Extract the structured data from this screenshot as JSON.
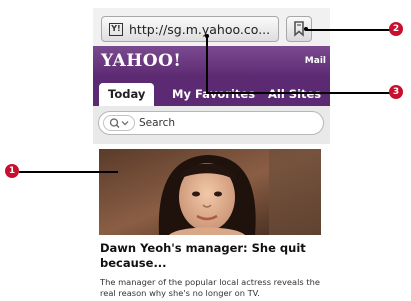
{
  "browser": {
    "url": "http://sg.m.yahoo.co...",
    "favicon_letter": "Y!"
  },
  "yahoo": {
    "logo": "YAHOO!",
    "mail_label": "Mail",
    "tabs": [
      {
        "label": "Today",
        "active": true
      },
      {
        "label": "My Favorites",
        "active": false
      },
      {
        "label": "All Sites",
        "active": false
      }
    ],
    "search_placeholder": "Search"
  },
  "news": {
    "headline": "Dawn Yeoh's manager: She quit because...",
    "summary": "The manager of the popular local actress reveals the real reason why she's no longer on TV."
  },
  "callouts": {
    "one": "1",
    "two": "2",
    "three": "3",
    "badge_color": "#c8102e"
  }
}
